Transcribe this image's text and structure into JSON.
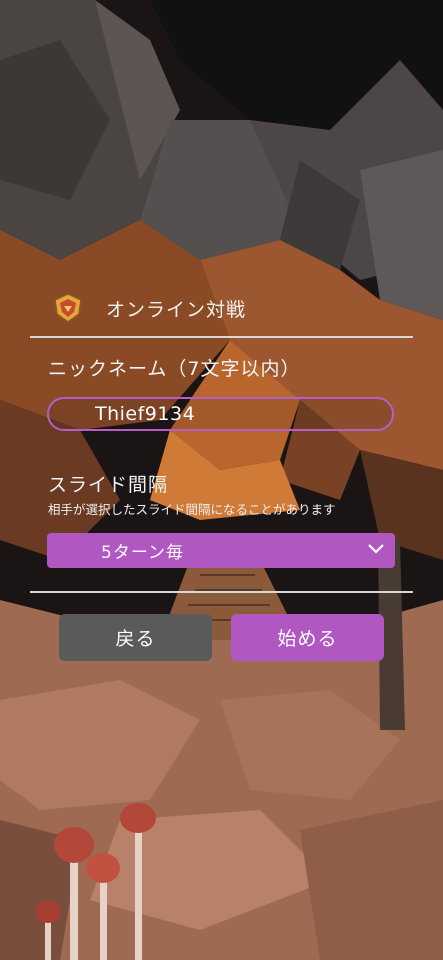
{
  "header": {
    "icon": "shield-emblem-icon",
    "title": "オンライン対戦"
  },
  "nickname": {
    "label": "ニックネーム（7文字以内）",
    "value": "Thief9134"
  },
  "slide_interval": {
    "label": "スライド間隔",
    "note": "相手が選択したスライド間隔になることがあります",
    "selected": "5ターン毎"
  },
  "buttons": {
    "back": "戻る",
    "start": "始める"
  },
  "colors": {
    "accent": "#b157c1",
    "back_button": "#5b5a5a",
    "field_border": "#b55ec6"
  }
}
